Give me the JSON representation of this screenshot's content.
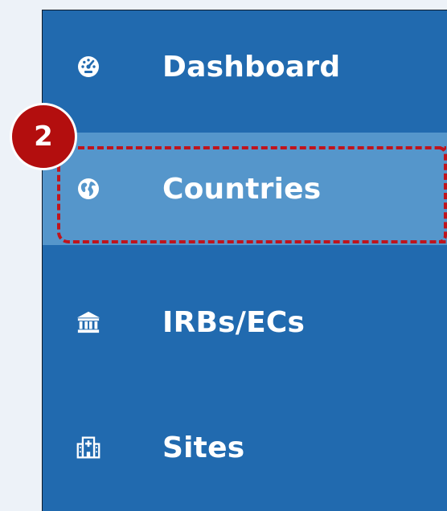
{
  "sidebar": {
    "items": [
      {
        "label": "Dashboard",
        "icon": "dashboard-gauge-icon",
        "active": false
      },
      {
        "label": "Countries",
        "icon": "globe-icon",
        "active": true
      },
      {
        "label": "IRBs/ECs",
        "icon": "institution-icon",
        "active": false
      },
      {
        "label": "Sites",
        "icon": "hospital-icon",
        "active": false
      }
    ]
  },
  "annotation": {
    "step_number": "2",
    "highlight_color": "#c0141c"
  },
  "colors": {
    "sidebar_bg": "#216aaf",
    "active_bg": "#5596cb",
    "page_bg": "#edf2f8",
    "text": "#ffffff"
  }
}
